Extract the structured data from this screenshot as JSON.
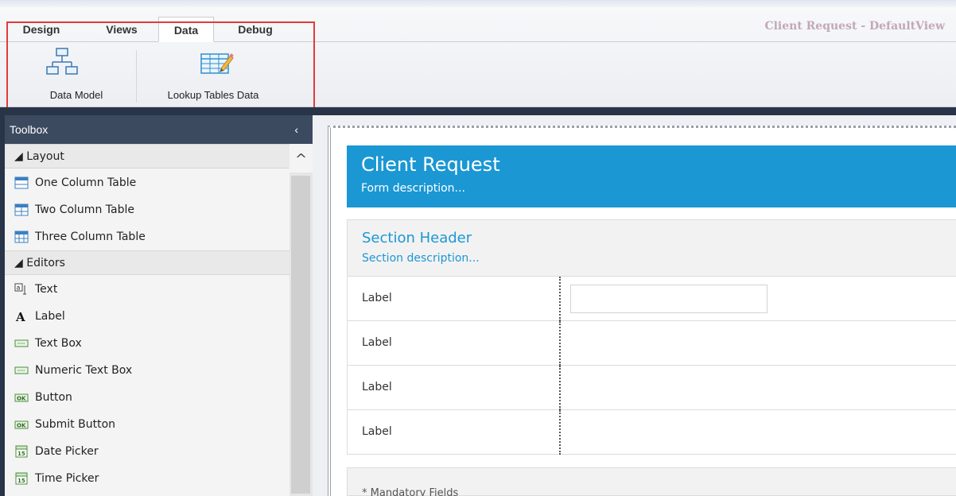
{
  "ribbon": {
    "tabs": [
      {
        "label": "Design",
        "active": false
      },
      {
        "label": "Views",
        "active": false
      },
      {
        "label": "Data",
        "active": true
      },
      {
        "label": "Debug",
        "active": false
      }
    ],
    "window_title": "Client Request - DefaultView",
    "buttons": [
      {
        "label": "Data Model",
        "icon": "data-model-icon"
      },
      {
        "label": "Lookup Tables Data",
        "icon": "lookup-tables-icon"
      }
    ],
    "highlight_color": "#e23b3b"
  },
  "toolbox": {
    "title": "Toolbox",
    "collapse_glyph": "‹",
    "groups": [
      {
        "label": "◢ Layout",
        "items": [
          {
            "label": "One Column Table",
            "icon": "one-column-table-icon"
          },
          {
            "label": "Two Column Table",
            "icon": "two-column-table-icon"
          },
          {
            "label": "Three Column Table",
            "icon": "three-column-table-icon"
          }
        ]
      },
      {
        "label": "◢ Editors",
        "items": [
          {
            "label": "Text",
            "icon": "text-icon"
          },
          {
            "label": "Label",
            "icon": "label-icon"
          },
          {
            "label": "Text Box",
            "icon": "textbox-icon"
          },
          {
            "label": "Numeric Text Box",
            "icon": "numeric-textbox-icon"
          },
          {
            "label": "Button",
            "icon": "button-icon"
          },
          {
            "label": "Submit Button",
            "icon": "submit-button-icon"
          },
          {
            "label": "Date Picker",
            "icon": "date-picker-icon"
          },
          {
            "label": "Time Picker",
            "icon": "time-picker-icon"
          }
        ]
      }
    ]
  },
  "form": {
    "title": "Client Request",
    "description": "Form description...",
    "section": {
      "title": "Section Header",
      "description": "Section description..."
    },
    "rows": [
      {
        "label": "Label"
      },
      {
        "label": "Label"
      },
      {
        "label": "Label"
      },
      {
        "label": "Label"
      }
    ],
    "footer_note": "* Mandatory Fields"
  },
  "colors": {
    "form_header": "#1b97d4",
    "toolbox_header": "#3c4a60",
    "dark_band": "#283448"
  }
}
